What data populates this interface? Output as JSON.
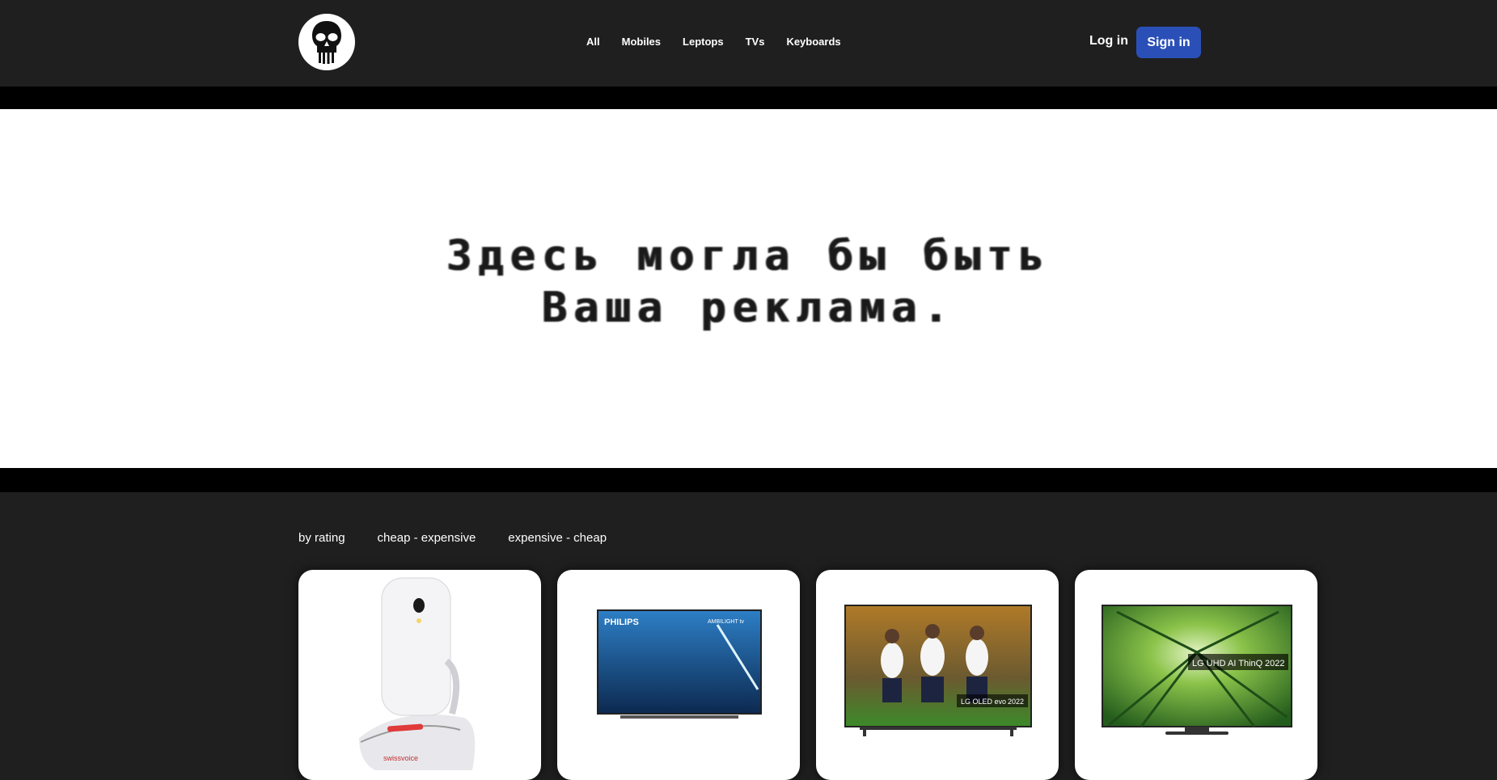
{
  "header": {
    "logo_icon": "skull-logo-icon",
    "nav": [
      "All",
      "Mobiles",
      "Leptops",
      "TVs",
      "Keyboards"
    ],
    "login_label": "Log in",
    "signin_label": "Sign in",
    "accent": "#2a50b8"
  },
  "banner": {
    "line1": "Здесь могла бы быть",
    "line2": "Ваша реклама."
  },
  "sort": {
    "options": [
      "by rating",
      "cheap - expensive",
      "expensive - cheap"
    ]
  },
  "products": [
    {
      "image": "white-flip-phone-on-dock",
      "brand_mark": "swissvoice"
    },
    {
      "image": "philips-ambilight-tv",
      "brand_mark": "PHILIPS",
      "badge": "AMBILIGHT tv"
    },
    {
      "image": "lg-oled-evo-tv",
      "badge": "LG OLED evo",
      "year": "2022"
    },
    {
      "image": "lg-uhd-tv",
      "badge": "LG UHD AI ThinQ",
      "year": "2022"
    }
  ]
}
